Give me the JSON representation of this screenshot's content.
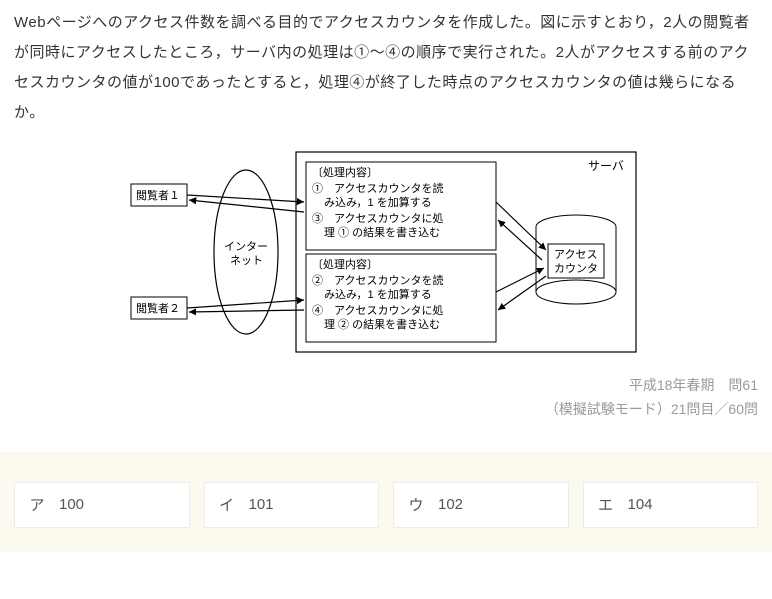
{
  "question": {
    "text": "Webページへのアクセス件数を調べる目的でアクセスカウンタを作成した。図に示すとおり，2人の閲覧者が同時にアクセスしたところ，サーバ内の処理は①～④の順序で実行された。2人がアクセスする前のアクセスカウンタの値が100であったとすると，処理④が終了した時点のアクセスカウンタの値は幾らになるか。"
  },
  "diagram": {
    "viewer1": "閲覧者１",
    "viewer2": "閲覧者２",
    "internet_l1": "インター",
    "internet_l2": "ネット",
    "server": "サーバ",
    "counter_l1": "アクセス",
    "counter_l2": "カウンタ",
    "box1_title": "〔処理内容〕",
    "box1_l1": "①　アクセスカウンタを読",
    "box1_l2": "み込み，1 を加算する",
    "box1_l3": "③　アクセスカウンタに処",
    "box1_l4": "理 ① の結果を書き込む",
    "box2_title": "〔処理内容〕",
    "box2_l1": "②　アクセスカウンタを読",
    "box2_l2": "み込み，1 を加算する",
    "box2_l3": "④　アクセスカウンタに処",
    "box2_l4": "理 ② の結果を書き込む"
  },
  "meta": {
    "exam_source": "平成18年春期　問61",
    "mode": "（模擬試験モード）21問目／60問"
  },
  "answers": [
    {
      "letter": "ア",
      "value": "100"
    },
    {
      "letter": "イ",
      "value": "101"
    },
    {
      "letter": "ウ",
      "value": "102"
    },
    {
      "letter": "エ",
      "value": "104"
    }
  ]
}
